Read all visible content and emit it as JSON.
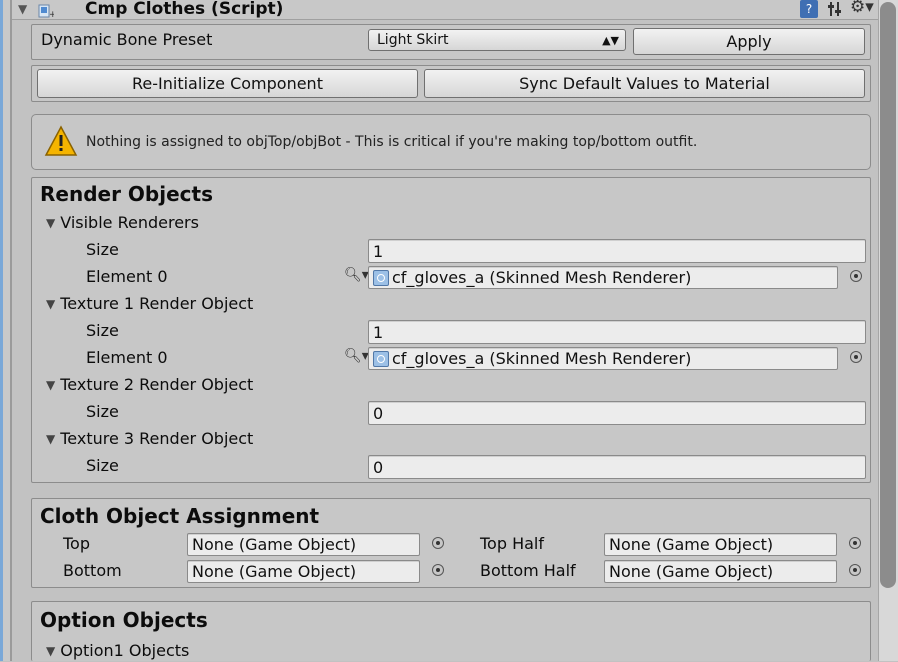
{
  "component": {
    "title": "Cmp Clothes (Script)"
  },
  "header_icons": [
    "help-icon",
    "preset-icon",
    "gear-icon"
  ],
  "preset": {
    "label": "Dynamic Bone Preset",
    "selected": "Light Skirt",
    "apply_label": "Apply"
  },
  "actions": {
    "reinit_label": "Re-Initialize Component",
    "sync_label": "Sync Default Values to Material"
  },
  "warning": {
    "message": "Nothing is assigned to objTop/objBot - This is critical if you're making top/bottom outfit."
  },
  "render_objects": {
    "title": "Render Objects",
    "groups": [
      {
        "label": "Visible Renderers",
        "size_label": "Size",
        "size": "1",
        "element_label": "Element 0",
        "element_value": "cf_gloves_a (Skinned Mesh Renderer)"
      },
      {
        "label": "Texture 1 Render Object",
        "size_label": "Size",
        "size": "1",
        "element_label": "Element 0",
        "element_value": "cf_gloves_a (Skinned Mesh Renderer)"
      },
      {
        "label": "Texture 2 Render Object",
        "size_label": "Size",
        "size": "0"
      },
      {
        "label": "Texture 3 Render Object",
        "size_label": "Size",
        "size": "0"
      }
    ]
  },
  "cloth_assignment": {
    "title": "Cloth Object Assignment",
    "top_label": "Top",
    "top_value": "None (Game Object)",
    "bottom_label": "Bottom",
    "bottom_value": "None (Game Object)",
    "top_half_label": "Top Half",
    "top_half_value": "None (Game Object)",
    "bottom_half_label": "Bottom Half",
    "bottom_half_value": "None (Game Object)"
  },
  "option_objects": {
    "title": "Option Objects",
    "option1_label": "Option1 Objects"
  },
  "colors": {
    "background": "#c2c2c2",
    "warning": "#f5b400",
    "accent": "#7aa8d8"
  }
}
